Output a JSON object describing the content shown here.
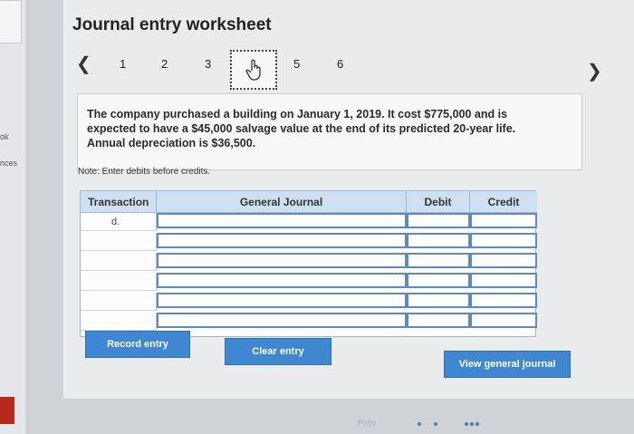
{
  "app": {
    "title": "Journal entry worksheet"
  },
  "sidebar": {
    "labels": [
      "ok",
      "nces"
    ]
  },
  "pager": {
    "prev_icon": "chevron-left-icon",
    "next_icon": "chevron-right-icon",
    "pages": [
      "1",
      "2",
      "3",
      "4",
      "5",
      "6"
    ],
    "current_index": 3
  },
  "problem": {
    "text": "The company purchased a building on January 1, 2019. It cost $775,000 and is expected to have a $45,000 salvage value at the end of its predicted 20-year life. Annual depreciation is $36,500."
  },
  "note": "Note: Enter debits before credits.",
  "journal": {
    "headers": {
      "transaction": "Transaction",
      "general_journal": "General Journal",
      "debit": "Debit",
      "credit": "Credit"
    },
    "rows": [
      {
        "transaction": "d.",
        "account": "",
        "debit": "",
        "credit": ""
      },
      {
        "transaction": "",
        "account": "",
        "debit": "",
        "credit": ""
      },
      {
        "transaction": "",
        "account": "",
        "debit": "",
        "credit": ""
      },
      {
        "transaction": "",
        "account": "",
        "debit": "",
        "credit": ""
      },
      {
        "transaction": "",
        "account": "",
        "debit": "",
        "credit": ""
      },
      {
        "transaction": "",
        "account": "",
        "debit": "",
        "credit": ""
      }
    ]
  },
  "buttons": {
    "record": "Record entry",
    "clear": "Clear entry",
    "view": "View general journal"
  },
  "footer": {
    "prev": "Prev"
  },
  "colors": {
    "accent": "#3f87d1",
    "header_bg": "#cfe0f3",
    "input_border": "#5f89c3"
  }
}
